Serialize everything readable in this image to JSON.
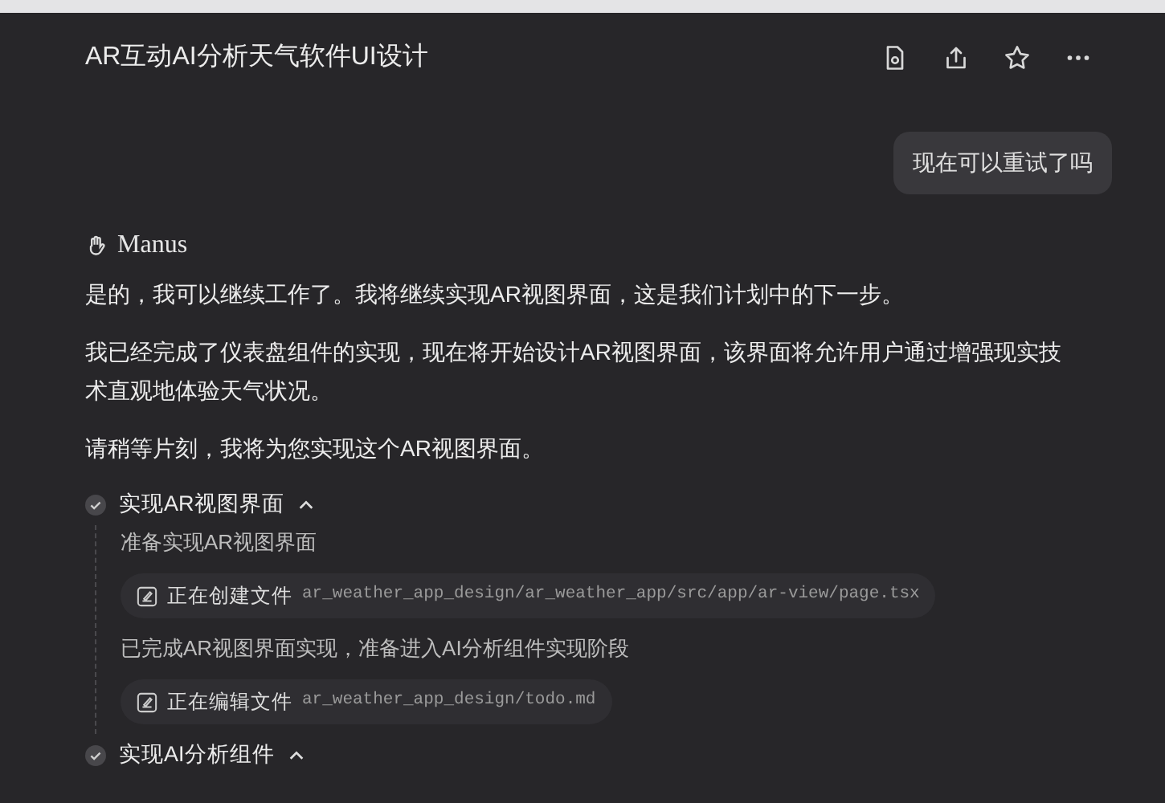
{
  "header": {
    "title": "AR互动AI分析天气软件UI设计"
  },
  "user_message": "现在可以重试了吗",
  "assistant": {
    "name": "Manus",
    "paragraphs": [
      "是的，我可以继续工作了。我将继续实现AR视图界面，这是我们计划中的下一步。",
      "我已经完成了仪表盘组件的实现，现在将开始设计AR视图界面，该界面将允许用户通过增强现实技术直观地体验天气状况。",
      "请稍等片刻，我将为您实现这个AR视图界面。"
    ]
  },
  "tasks": [
    {
      "title": "实现AR视图界面",
      "done": true,
      "expanded": true,
      "steps": [
        {
          "kind": "note",
          "text": "准备实现AR视图界面"
        },
        {
          "kind": "action",
          "label": "正在创建文件",
          "path": "ar_weather_app_design/ar_weather_app/src/app/ar-view/page.tsx"
        },
        {
          "kind": "note",
          "text": "已完成AR视图界面实现，准备进入AI分析组件实现阶段"
        },
        {
          "kind": "action",
          "label": "正在编辑文件",
          "path": "ar_weather_app_design/todo.md"
        }
      ]
    },
    {
      "title": "实现AI分析组件",
      "done": true,
      "expanded": true
    }
  ]
}
